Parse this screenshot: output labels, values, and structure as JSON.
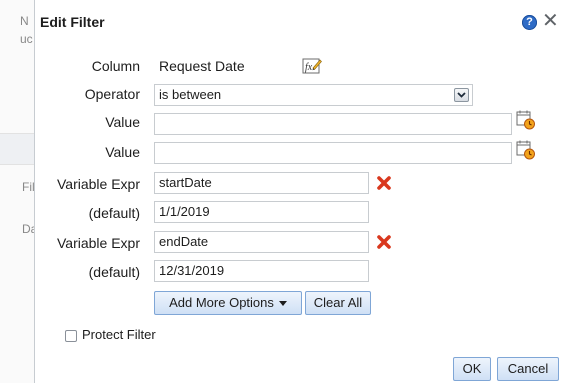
{
  "background": {
    "fragments": [
      "N",
      "uc",
      "Fil",
      "Da"
    ]
  },
  "dialog": {
    "title": "Edit Filter",
    "help_icon_glyph": "?",
    "close_icon_glyph": "✕"
  },
  "form": {
    "column_label": "Column",
    "column_value": "Request Date",
    "operator_label": "Operator",
    "operator_value": "is between",
    "value1_label": "Value",
    "value1_value": "",
    "value2_label": "Value",
    "value2_value": "",
    "var1_label": "Variable Expr",
    "var1_value": "startDate",
    "default1_label": "(default)",
    "default1_value": "1/1/2019",
    "var2_label": "Variable Expr",
    "var2_value": "endDate",
    "default2_label": "(default)",
    "default2_value": "12/31/2019"
  },
  "buttons": {
    "add_more_options": "Add More Options",
    "clear_all": "Clear All",
    "ok": "OK",
    "cancel": "Cancel"
  },
  "protect_filter": {
    "label": "Protect Filter",
    "checked": false
  },
  "icons": {
    "edit": "edit-column-formula-icon",
    "calendar": "calendar-clock-icon",
    "delete": "delete-x-icon",
    "help": "help-icon",
    "close": "close-icon"
  },
  "colors": {
    "accent_blue": "#2e6bc6",
    "delete_red": "#d9381e",
    "button_border": "#7fa6d6"
  }
}
